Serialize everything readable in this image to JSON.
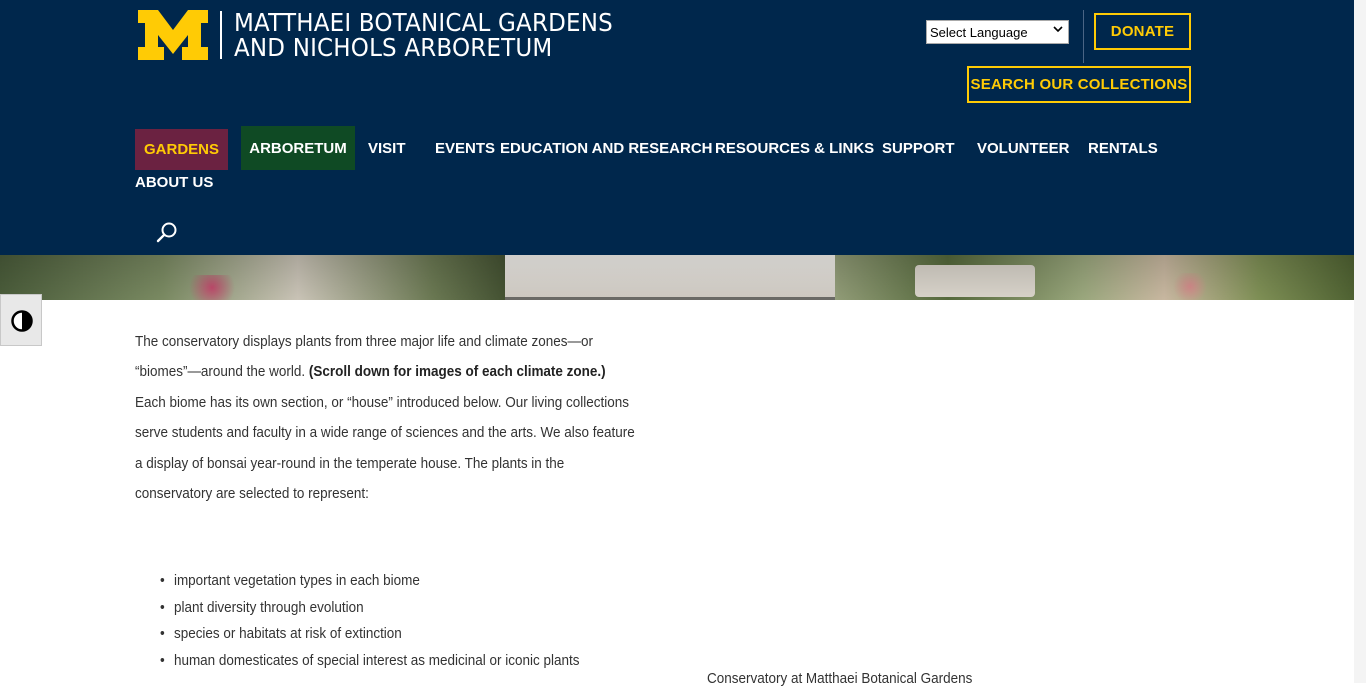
{
  "header": {
    "logo_line1": "MATTHAEI BOTANICAL GARDENS",
    "logo_line2": "AND NICHOLS ARBORETUM",
    "language_select": "Select Language",
    "donate_label": "DONATE",
    "search_collections_label": "SEARCH OUR COLLECTIONS"
  },
  "nav": {
    "items": [
      {
        "label": "GARDENS"
      },
      {
        "label": "ARBORETUM"
      },
      {
        "label": "VISIT"
      },
      {
        "label": "EVENTS"
      },
      {
        "label": "EDUCATION AND RESEARCH"
      },
      {
        "label": "RESOURCES & LINKS"
      },
      {
        "label": "SUPPORT"
      },
      {
        "label": "VOLUNTEER"
      },
      {
        "label": "RENTALS"
      },
      {
        "label": "ABOUT US"
      }
    ],
    "search_icon": "search-icon"
  },
  "accessibility": {
    "contrast_icon": "contrast-toggle-icon"
  },
  "content": {
    "intro_part1": "The conservatory displays plants from three major life and climate zones—or “biomes”—around the world. ",
    "intro_bold": "(Scroll down for images of each climate zone.)",
    "intro_part2": " Each biome has its own section, or “house” introduced below. Our living collections serve students and faculty in a wide range of sciences and the arts. We also feature a display of bonsai year-round in the temperate house. The plants in the conservatory are selected to represent:",
    "bullets": [
      "important vegetation types in each biome",
      "plant diversity through evolution",
      "species or habitats at risk of extinction",
      "human domesticates of special interest as medicinal or iconic plants"
    ],
    "image_caption": "Conservatory at Matthaei Botanical Gardens"
  },
  "colors": {
    "header_bg": "#00274c",
    "accent_maize": "#ffcb05",
    "gardens_bg": "#6b2241",
    "arboretum_bg": "#0f4a24"
  }
}
